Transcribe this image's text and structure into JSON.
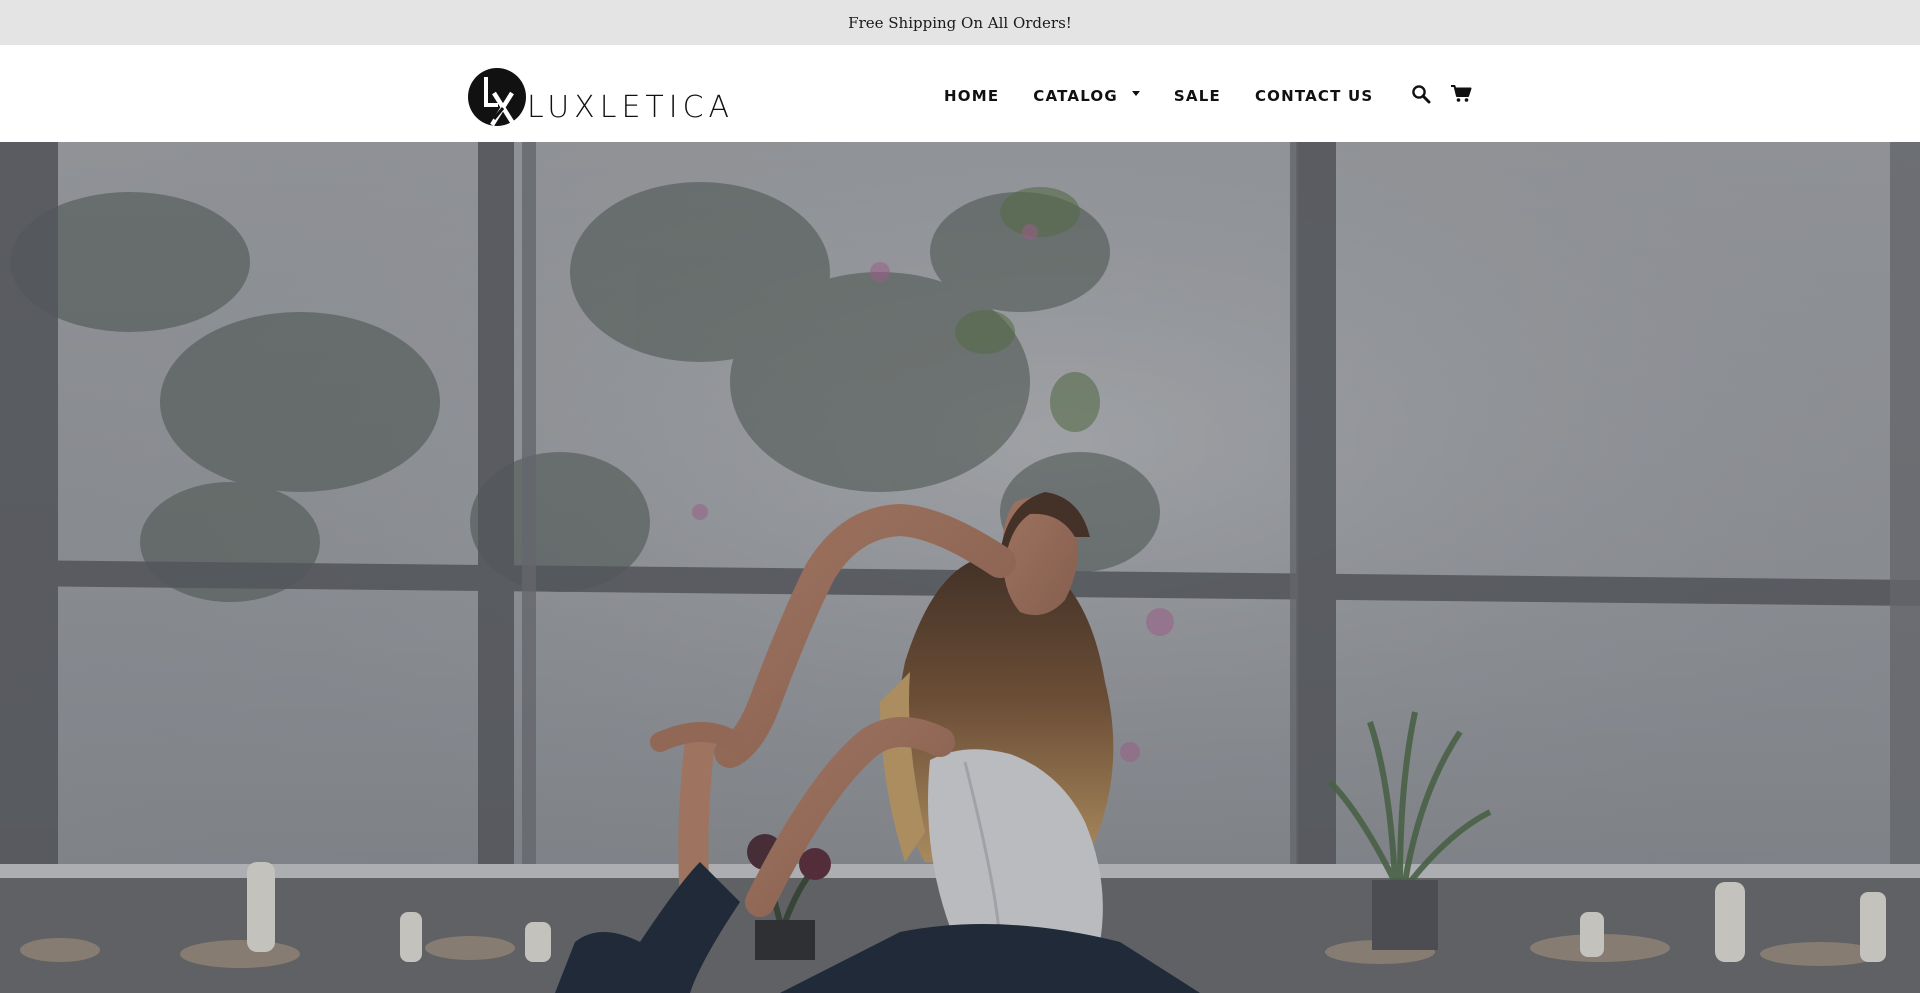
{
  "announcement": {
    "text": "Free Shipping On All Orders!"
  },
  "header": {
    "brand": {
      "mark": "LX",
      "name": "LUXLETICA"
    },
    "nav": [
      {
        "label": "HOME"
      },
      {
        "label": "CATALOG",
        "has_dropdown": true
      },
      {
        "label": "SALE"
      },
      {
        "label": "CONTACT US"
      }
    ],
    "icons": [
      "search-icon",
      "cart-icon"
    ]
  },
  "hero": {
    "image": "woman-yoga-pose-in-greenhouse"
  },
  "colors": {
    "announcement_bg": "#e4e4e4",
    "text": "#111111",
    "header_bg": "#ffffff"
  }
}
